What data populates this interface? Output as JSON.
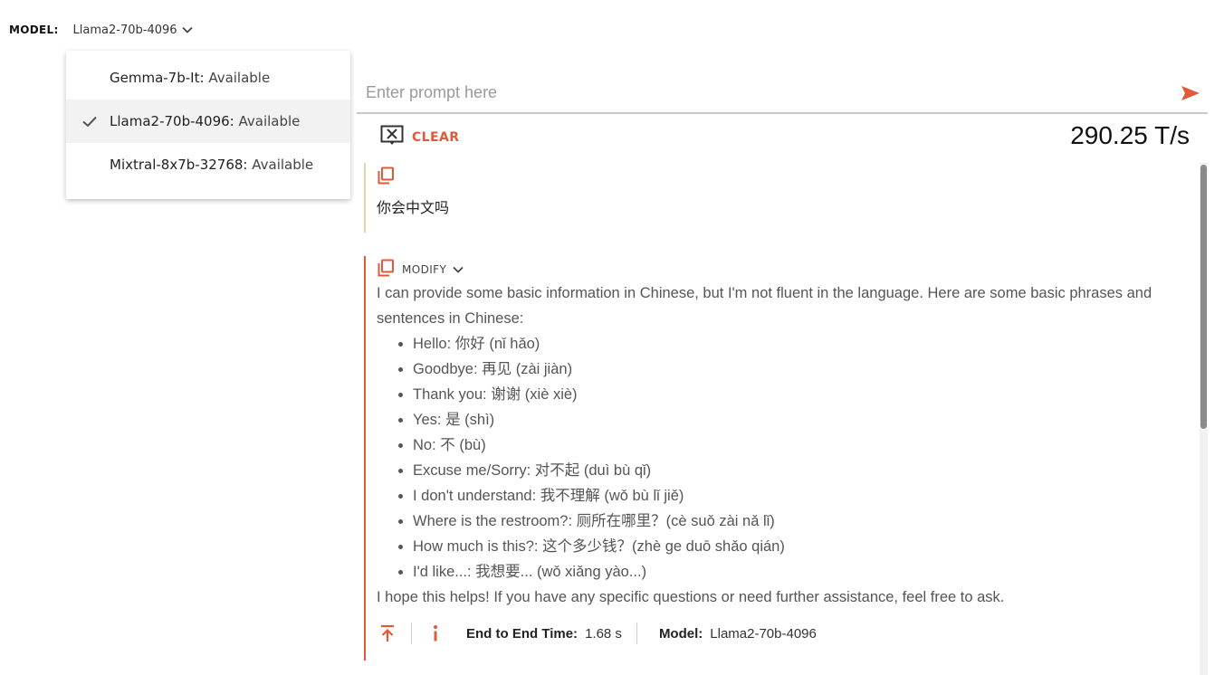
{
  "colors": {
    "accent": "#e05a3a",
    "user_border": "#e3d3ae",
    "selected_bg": "#f2f2f2"
  },
  "model_bar": {
    "label": "MODEL:",
    "selected": "Llama2-70b-4096"
  },
  "dropdown": {
    "items": [
      {
        "name": "Gemma-7b-It:",
        "status": "Available",
        "selected": false
      },
      {
        "name": "Llama2-70b-4096:",
        "status": "Available",
        "selected": true
      },
      {
        "name": "Mixtral-8x7b-32768:",
        "status": "Available",
        "selected": false
      }
    ]
  },
  "prompt": {
    "placeholder": "Enter prompt here",
    "value": ""
  },
  "toolbar": {
    "clear_label": "CLEAR",
    "speed": "290.25 T/s"
  },
  "messages": {
    "user": {
      "text": "你会中文吗"
    },
    "bot": {
      "modify_label": "MODIFY",
      "intro": "I can provide some basic information in Chinese, but I'm not fluent in the language. Here are some basic phrases and sentences in Chinese:",
      "items": [
        "Hello: 你好 (nǐ hǎo)",
        "Goodbye: 再见 (zài jiàn)",
        "Thank you: 谢谢 (xiè xiè)",
        "Yes: 是 (shì)",
        "No: 不 (bù)",
        "Excuse me/Sorry: 对不起 (duì bù qǐ)",
        "I don't understand: 我不理解 (wǒ bù lǐ jiě)",
        "Where is the restroom?: 厕所在哪里？(cè suǒ zài nǎ lǐ)",
        "How much is this?: 这个多少钱？(zhè ge duō shǎo qián)",
        "I'd like...: 我想要... (wǒ xiǎng yào...)"
      ],
      "outro": "I hope this helps! If you have any specific questions or need further assistance, feel free to ask.",
      "footer": {
        "time_label": "End to End Time:",
        "time_value": "1.68 s",
        "model_label": "Model:",
        "model_value": "Llama2-70b-4096"
      }
    }
  },
  "icons": [
    "chevron-down-icon",
    "check-icon",
    "send-icon",
    "clear-icon",
    "copy-icon",
    "arrow-up-icon",
    "info-icon"
  ]
}
